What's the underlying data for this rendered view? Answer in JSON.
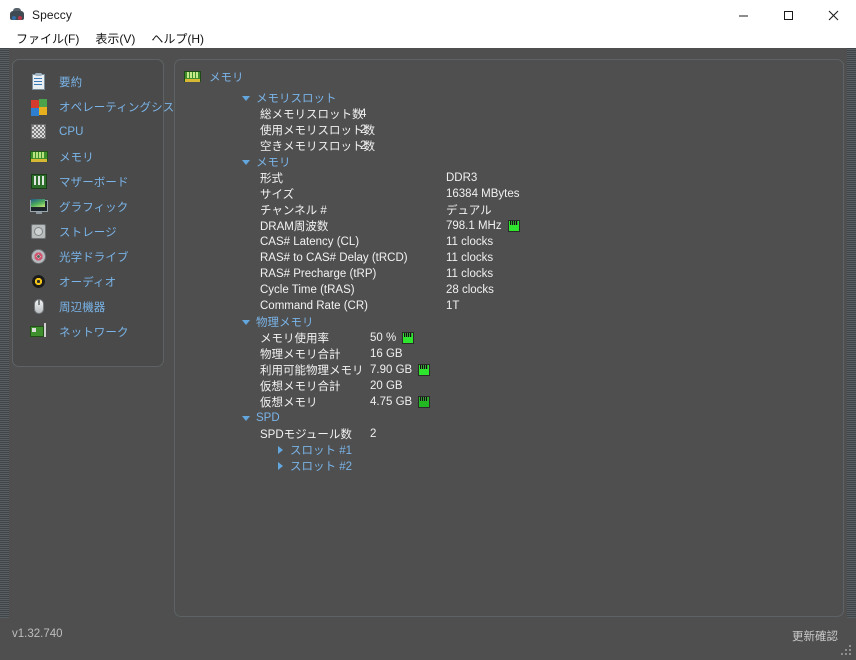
{
  "window": {
    "title": "Speccy",
    "icon": "speccy-app-icon",
    "controls": {
      "minimize": "minimize-button",
      "maximize": "maximize-button",
      "close": "close-button"
    }
  },
  "menubar": {
    "items": [
      {
        "label": "ファイル(F)",
        "name": "menu-file"
      },
      {
        "label": "表示(V)",
        "name": "menu-view"
      },
      {
        "label": "ヘルプ(H)",
        "name": "menu-help"
      }
    ]
  },
  "sidebar": {
    "items": [
      {
        "label": "要約",
        "icon": "clipboard-icon",
        "name": "sidebar-item-summary"
      },
      {
        "label": "オペレーティングシステム",
        "icon": "windows-icon",
        "name": "sidebar-item-operating-system"
      },
      {
        "label": "CPU",
        "icon": "cpu-icon",
        "name": "sidebar-item-cpu"
      },
      {
        "label": "メモリ",
        "icon": "ram-icon",
        "name": "sidebar-item-memory"
      },
      {
        "label": "マザーボード",
        "icon": "motherboard-icon",
        "name": "sidebar-item-motherboard"
      },
      {
        "label": "グラフィック",
        "icon": "monitor-icon",
        "name": "sidebar-item-graphics"
      },
      {
        "label": "ストレージ",
        "icon": "harddisk-icon",
        "name": "sidebar-item-storage"
      },
      {
        "label": "光学ドライブ",
        "icon": "optical-disc-icon",
        "name": "sidebar-item-optical-drives"
      },
      {
        "label": "オーディオ",
        "icon": "speaker-icon",
        "name": "sidebar-item-audio"
      },
      {
        "label": "周辺機器",
        "icon": "mouse-icon",
        "name": "sidebar-item-peripherals"
      },
      {
        "label": "ネットワーク",
        "icon": "network-card-icon",
        "name": "sidebar-item-network"
      }
    ]
  },
  "content": {
    "header": {
      "title": "メモリ",
      "icon": "ram-icon"
    },
    "groups": [
      {
        "name": "メモリスロット",
        "expanded": true,
        "rows": [
          {
            "label": "総メモリスロット数",
            "value": "4",
            "meter": false
          },
          {
            "label": "使用メモリスロット数",
            "value": "2",
            "meter": false
          },
          {
            "label": "空きメモリスロット数",
            "value": "2",
            "meter": false
          }
        ]
      },
      {
        "name": "メモリ",
        "expanded": true,
        "rows": [
          {
            "label": "形式",
            "value": "DDR3",
            "meter": false
          },
          {
            "label": "サイズ",
            "value": "16384 MBytes",
            "meter": false
          },
          {
            "label": "チャンネル #",
            "value": "デュアル",
            "meter": false
          },
          {
            "label": "DRAM周波数",
            "value": "798.1 MHz",
            "meter": true
          },
          {
            "label": "CAS# Latency (CL)",
            "value": "11 clocks",
            "meter": false
          },
          {
            "label": "RAS# to CAS# Delay (tRCD)",
            "value": "11 clocks",
            "meter": false
          },
          {
            "label": "RAS# Precharge (tRP)",
            "value": "11 clocks",
            "meter": false
          },
          {
            "label": "Cycle Time (tRAS)",
            "value": "28 clocks",
            "meter": false
          },
          {
            "label": "Command Rate (CR)",
            "value": "1T",
            "meter": false
          }
        ]
      },
      {
        "name": "物理メモリ",
        "expanded": true,
        "rows": [
          {
            "label": "メモリ使用率",
            "value": "50 %",
            "meter": true
          },
          {
            "label": "物理メモリ合計",
            "value": "16 GB",
            "meter": false
          },
          {
            "label": "利用可能物理メモリ",
            "value": "7.90 GB",
            "meter": true
          },
          {
            "label": "仮想メモリ合計",
            "value": "20 GB",
            "meter": false
          },
          {
            "label": "仮想メモリ",
            "value": "4.75 GB",
            "meter": true
          }
        ]
      },
      {
        "name": "SPD",
        "expanded": true,
        "rows": [
          {
            "label": "SPDモジュール数",
            "value": "2",
            "meter": false
          }
        ],
        "subgroups": [
          {
            "name": "スロット #1",
            "expanded": false
          },
          {
            "name": "スロット #2",
            "expanded": false
          }
        ]
      }
    ]
  },
  "statusbar": {
    "version": "v1.32.740",
    "update_label": "更新確認"
  },
  "colors": {
    "accent_blue": "#7ab4e8",
    "panel_bg": "#4f4f4f",
    "sidebar_bg": "#4a4a4a",
    "meter_green": "#2ee62e",
    "titlebar_bg": "#ffffff"
  }
}
